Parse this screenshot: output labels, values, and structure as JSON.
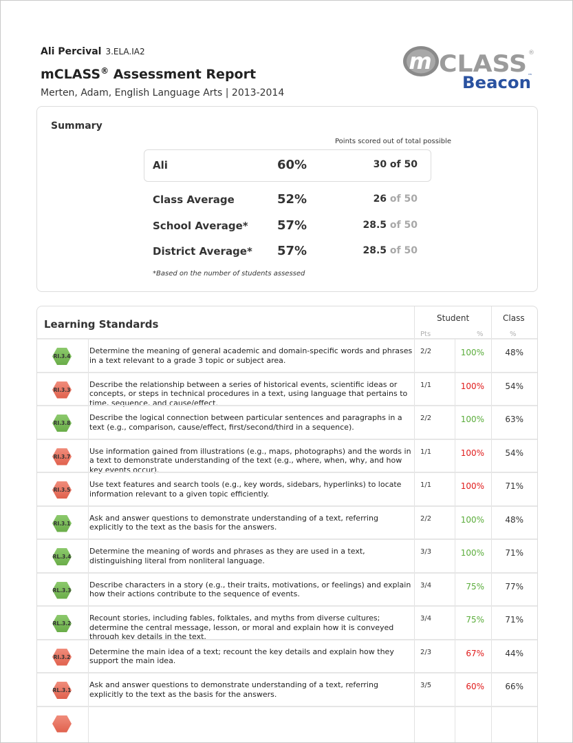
{
  "header": {
    "student_name": "Ali Percival",
    "assessment_code": "3.ELA.IA2",
    "report_title": "mCLASS",
    "report_title_mark": "®",
    "report_title_rest": " Assessment Report",
    "subtitle": "Merten, Adam, English Language Arts | 2013-2014"
  },
  "logo": {
    "m_letter": "m",
    "class_text": "CLASS",
    "registered": "®",
    "beacon_text": "Beacon",
    "trademark": "™"
  },
  "summary": {
    "title": "Summary",
    "points_note": "Points scored out of total possible",
    "rows": [
      {
        "label": "Ali",
        "percent": "60%",
        "points": "30 of 50",
        "of_total": ""
      },
      {
        "label": "Class Average",
        "percent": "52%",
        "points": "26",
        "of_total": " of 50"
      },
      {
        "label": "School Average*",
        "percent": "57%",
        "points": "28.5",
        "of_total": " of 50"
      },
      {
        "label": "District Average*",
        "percent": "57%",
        "points": "28.5",
        "of_total": " of 50"
      }
    ],
    "footnote": "*Based on the number of students assessed"
  },
  "standards": {
    "title": "Learning Standards",
    "student_header": "Student",
    "class_header": "Class",
    "pts_subheader": "Pts",
    "pct_subheader": "%",
    "class_pct_subheader": "%",
    "colors": {
      "green": "#6aad49",
      "red": "#e0614d"
    },
    "rows": [
      {
        "code": "RI.3.4",
        "status": "green",
        "description": "Determine the meaning of general academic and domain-specific words and phrases in a text relevant to a grade 3 topic or subject area.",
        "pts": "2/2",
        "student_pct": "100%",
        "student_color": "green",
        "class_pct": "48%"
      },
      {
        "code": "RI.3.3",
        "status": "red",
        "description": "Describe the relationship between a series of historical events, scientific ideas or concepts, or steps in technical procedures in a text, using language that pertains to time, sequence, and cause/effect.",
        "pts": "1/1",
        "student_pct": "100%",
        "student_color": "red",
        "class_pct": "54%"
      },
      {
        "code": "RI.3.8",
        "status": "green",
        "description": "Describe the logical connection between particular sentences and paragraphs in a text (e.g., comparison, cause/effect, first/second/third in a sequence).",
        "pts": "2/2",
        "student_pct": "100%",
        "student_color": "green",
        "class_pct": "63%"
      },
      {
        "code": "RI.3.7",
        "status": "red",
        "description": "Use information gained from illustrations (e.g., maps, photographs) and the words in a text to demonstrate understanding of the text (e.g., where, when, why, and how key events occur).",
        "pts": "1/1",
        "student_pct": "100%",
        "student_color": "red",
        "class_pct": "54%"
      },
      {
        "code": "RI.3.5",
        "status": "red",
        "description": "Use text features and search tools (e.g., key words, sidebars, hyperlinks) to locate information relevant to a given topic efficiently.",
        "pts": "1/1",
        "student_pct": "100%",
        "student_color": "red",
        "class_pct": "71%"
      },
      {
        "code": "RI.3.1",
        "status": "green",
        "description": "Ask and answer questions to demonstrate understanding of a text, referring explicitly to the text as the basis for the answers.",
        "pts": "2/2",
        "student_pct": "100%",
        "student_color": "green",
        "class_pct": "48%"
      },
      {
        "code": "RL.3.4",
        "status": "green",
        "description": "Determine the meaning of words and phrases as they are used in a text, distinguishing literal from nonliteral language.",
        "pts": "3/3",
        "student_pct": "100%",
        "student_color": "green",
        "class_pct": "71%"
      },
      {
        "code": "RL.3.3",
        "status": "green",
        "description": "Describe characters in a story (e.g., their traits, motivations, or feelings) and explain how their actions contribute to the sequence of events.",
        "pts": "3/4",
        "student_pct": "75%",
        "student_color": "green",
        "class_pct": "77%"
      },
      {
        "code": "RL.3.2",
        "status": "green",
        "description": "Recount stories, including fables, folktales, and myths from diverse cultures; determine the central message, lesson, or moral and explain how it is conveyed through key details in the text.",
        "pts": "3/4",
        "student_pct": "75%",
        "student_color": "green",
        "class_pct": "71%"
      },
      {
        "code": "RI.3.2",
        "status": "red",
        "description": "Determine the main idea of a text; recount the key details and explain how they support the main idea.",
        "pts": "2/3",
        "student_pct": "67%",
        "student_color": "red",
        "class_pct": "44%"
      },
      {
        "code": "RL.3.1",
        "status": "red",
        "description": "Ask and answer questions to demonstrate understanding of a text, referring explicitly to the text as the basis for the answers.",
        "pts": "3/5",
        "student_pct": "60%",
        "student_color": "red",
        "class_pct": "66%"
      },
      {
        "code": "",
        "status": "red",
        "description": "",
        "pts": "",
        "student_pct": "",
        "student_color": "red",
        "class_pct": ""
      }
    ]
  }
}
